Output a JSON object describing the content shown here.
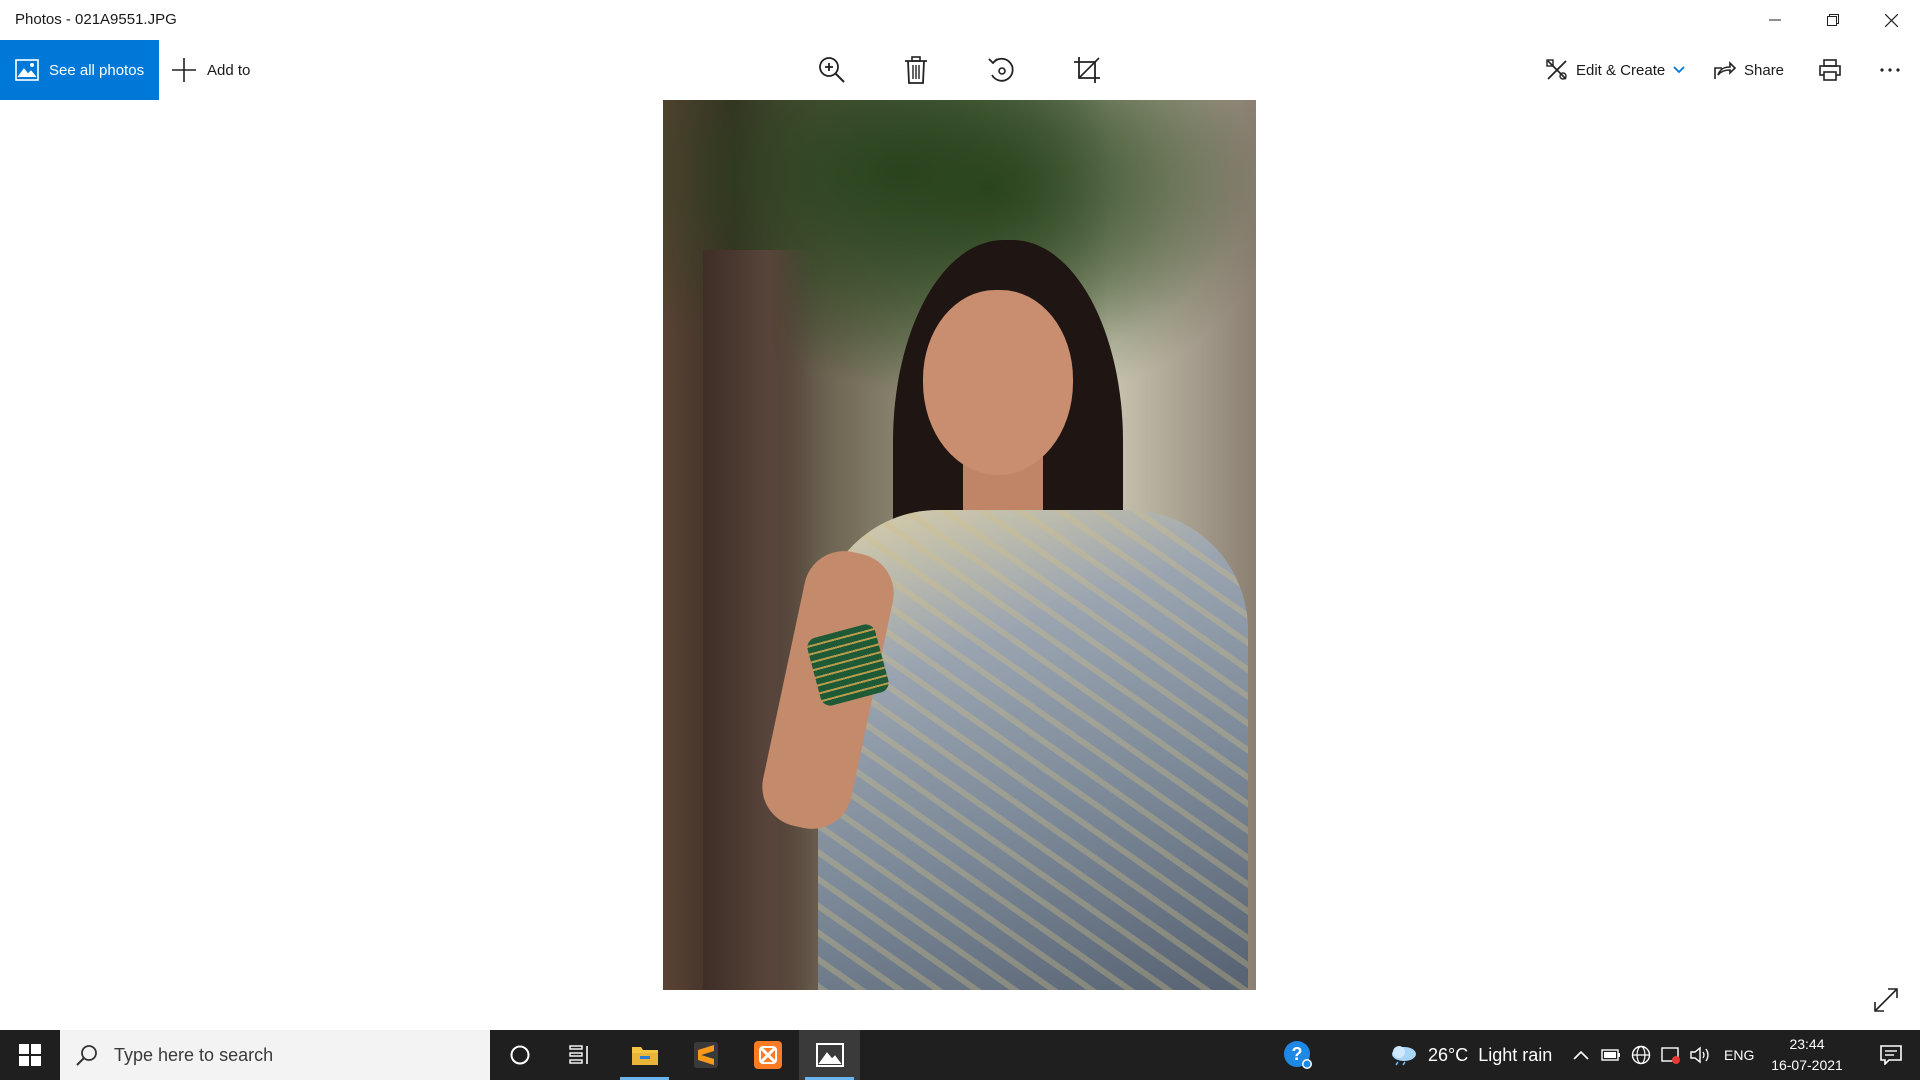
{
  "window": {
    "title": "Photos - 021A9551.JPG"
  },
  "toolbar": {
    "see_all_photos": "See all photos",
    "add_to": "Add to",
    "edit_create": "Edit & Create",
    "share": "Share",
    "icons": [
      "zoom-in-icon",
      "delete-icon",
      "rotate-icon",
      "crop-icon",
      "print-icon",
      "more-icon"
    ]
  },
  "colors": {
    "accent": "#0078d7",
    "taskbar": "#1f1f1f"
  },
  "taskbar": {
    "search_placeholder": "Type here to search",
    "weather": {
      "temperature": "26°C",
      "condition": "Light rain"
    },
    "language": "ENG",
    "time": "23:44",
    "date": "16-07-2021"
  }
}
